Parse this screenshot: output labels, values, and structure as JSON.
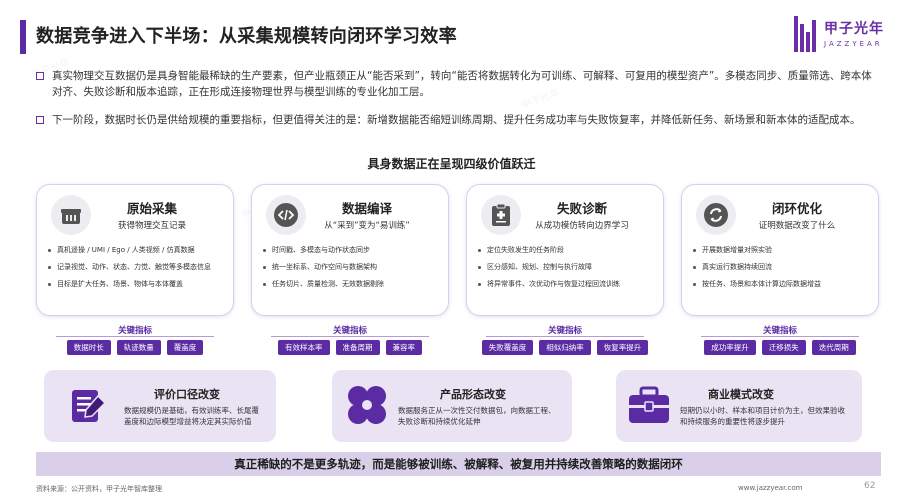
{
  "header": {
    "title": "数据竞争进入下半场：从采集规模转向闭环学习效率",
    "logo_cn": "甲子光年",
    "logo_en": "JAZZYEAR"
  },
  "intro": {
    "bullets": [
      "真实物理交互数据仍是具身智能最稀缺的生产要素，但产业瓶颈正从“能否采到”，转向“能否将数据转化为可训练、可解释、可复用的模型资产”。多模态同步、质量筛选、跨本体对齐、失败诊断和版本追踪，正在形成连接物理世界与模型训练的专业化加工层。",
      "下一阶段，数据时长仍是供给规模的重要指标，但更值得关注的是：新增数据能否缩短训练周期、提升任务成功率与失败恢复率，并降低新任务、新场景和新本体的适配成本。"
    ]
  },
  "section_title": "具身数据正在呈现四级价值跃迁",
  "stages": [
    {
      "title": "原始采集",
      "subtitle": "获得物理交互记录",
      "icon": "basket-icon",
      "items": [
        "真机遥操 / UMI / Ego / 人类视频 / 仿真数据",
        "记录视觉、动作、状态、力觉、触觉等多模态信息",
        "目标是扩大任务、场景、物体与本体覆盖"
      ],
      "kpi_label": "关键指标",
      "kpis": [
        "数据时长",
        "轨迹数量",
        "覆盖度"
      ]
    },
    {
      "title": "数据编译",
      "subtitle": "从“采到”变为“易训练”",
      "icon": "code-icon",
      "items": [
        "时间戳、多模态与动作状态同步",
        "统一坐标系、动作空间与数据架构",
        "任务切片、质量检测、无效数据剔除"
      ],
      "kpi_label": "关键指标",
      "kpis": [
        "有效样本率",
        "准备周期",
        "兼容率"
      ]
    },
    {
      "title": "失败诊断",
      "subtitle": "从成功模仿转向边界学习",
      "icon": "medical-clipboard-icon",
      "items": [
        "定位失败发生的任务阶段",
        "区分感知、规划、控制与执行故障",
        "将异常事件、次优动作与恢复过程回流训练"
      ],
      "kpi_label": "关键指标",
      "kpis": [
        "失败覆盖度",
        "相似归纳率",
        "恢复率提升"
      ]
    },
    {
      "title": "闭环优化",
      "subtitle": "证明数据改变了什么",
      "icon": "refresh-cycle-icon",
      "items": [
        "开展数据增量对照实验",
        "真实运行数据持续回流",
        "按任务、场景和本体计算边际数据增益"
      ],
      "kpi_label": "关键指标",
      "kpis": [
        "成功率提升",
        "迁移损失",
        "迭代周期"
      ]
    }
  ],
  "changes": [
    {
      "title": "评价口径改变",
      "icon": "pencil-paper-icon",
      "desc": "数据规模仍是基础，有效训练率、长尾覆盖度和边际模型增益将决定其实际价值"
    },
    {
      "title": "产品形态改变",
      "icon": "four-petal-icon",
      "desc": "数据服务正从一次性交付数据包，向数据工程、失败诊断和持续优化延伸"
    },
    {
      "title": "商业模式改变",
      "icon": "briefcase-icon",
      "desc": "短期仍以小时、样本和项目计价为主，但效果验收和持续服务的重要性将逐步提升"
    }
  ],
  "banner": "真正稀缺的不是更多轨迹，而是能够被训练、被解释、被复用并持续改善策略的数据闭环",
  "footer": {
    "source": "资料来源：公开资料，甲子光年智库整理",
    "url": "www.jazzyear.com",
    "page": "62"
  },
  "colors": {
    "brand": "#5a2ba3",
    "light": "#eae3f4",
    "banner": "#d9cfe9"
  }
}
